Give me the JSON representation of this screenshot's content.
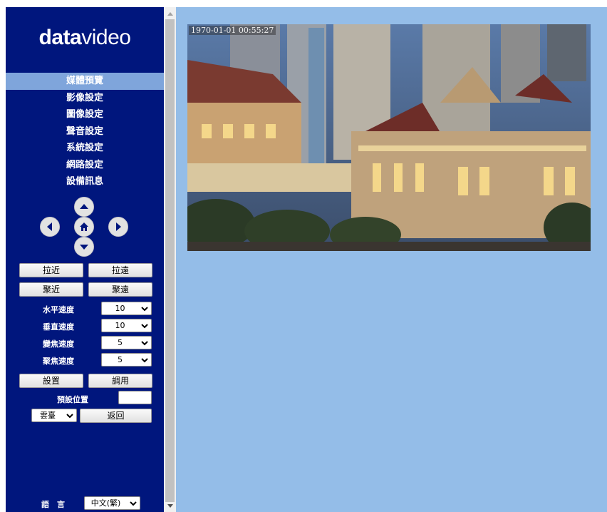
{
  "logo": {
    "bold": "data",
    "light": "video"
  },
  "menu": [
    {
      "label": "媒體預覽",
      "active": true
    },
    {
      "label": "影像設定"
    },
    {
      "label": "圖像設定"
    },
    {
      "label": "聲音設定"
    },
    {
      "label": "系統設定"
    },
    {
      "label": "網路設定"
    },
    {
      "label": "設備訊息"
    }
  ],
  "ptz": {
    "zoom_in": "拉近",
    "zoom_out": "拉遠",
    "focus_near": "聚近",
    "focus_far": "聚遠"
  },
  "speeds": {
    "pan_label": "水平速度",
    "pan_value": "10",
    "tilt_label": "垂直速度",
    "tilt_value": "10",
    "zoom_label": "變焦速度",
    "zoom_value": "5",
    "focus_label": "聚焦速度",
    "focus_value": "5"
  },
  "preset": {
    "set": "設置",
    "call": "調用",
    "position_label": "預設位置",
    "position_value": "",
    "mode_value": "雲臺",
    "back": "返回"
  },
  "language": {
    "label": "語　言",
    "value": "中文(繁)"
  },
  "video": {
    "timestamp": "1970-01-01 00:55:27"
  },
  "colors": {
    "sidebar": "#00167d",
    "active_menu": "#7fa5db",
    "main_bg": "#94bde8"
  },
  "icons": [
    "up-arrow-icon",
    "left-arrow-icon",
    "home-icon",
    "right-arrow-icon",
    "down-arrow-icon",
    "chevron-down-icon"
  ]
}
